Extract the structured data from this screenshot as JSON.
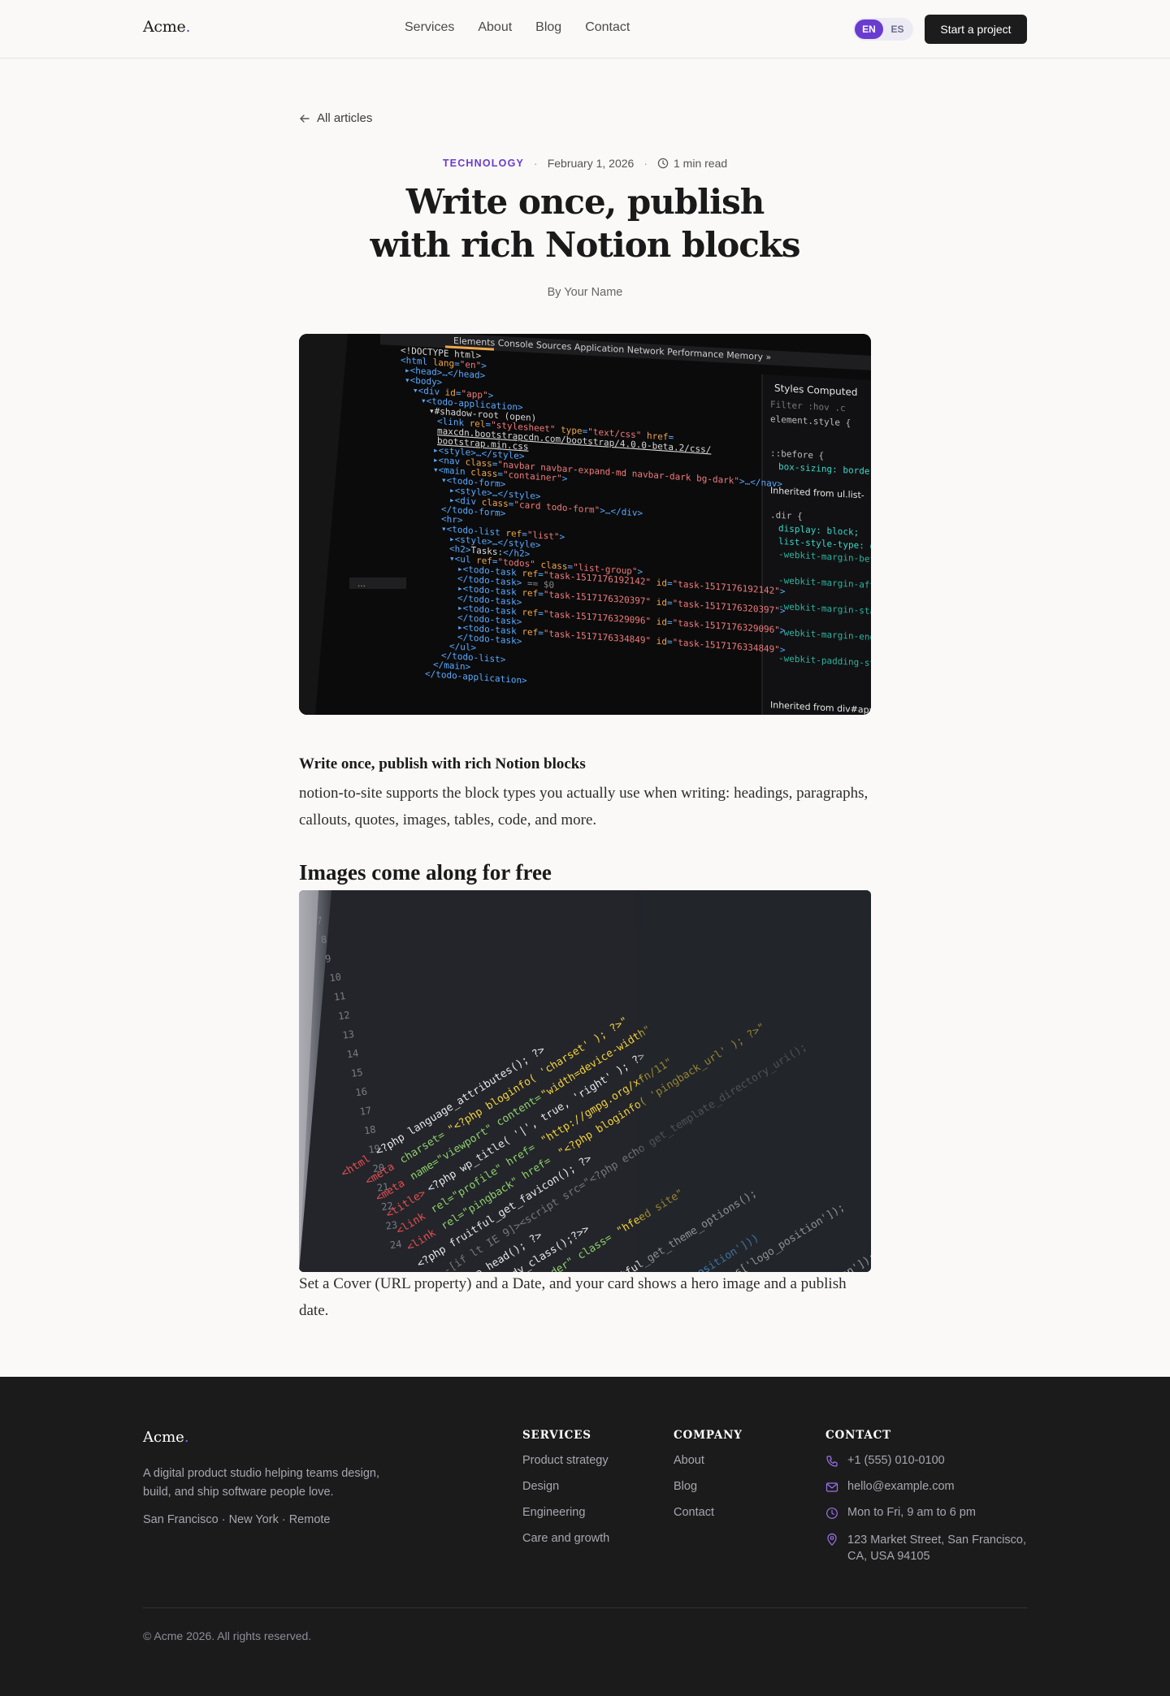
{
  "header": {
    "logo": "Acme",
    "logo_dot": ".",
    "nav": [
      "Services",
      "About",
      "Blog",
      "Contact"
    ],
    "lang_active": "EN",
    "lang_inactive": "ES",
    "cta": "Start a project"
  },
  "article": {
    "back_label": "All articles",
    "category": "TECHNOLOGY",
    "date": "February 1, 2026",
    "read_time": "1 min read",
    "title_line1": "Write once, publish",
    "title_line2": "with rich Notion blocks",
    "byline": "By Your Name",
    "body_heading": "Write once, publish with rich Notion blocks",
    "body_paragraph": "notion-to-site supports the block types you actually use when writing: headings, paragraphs, callouts, quotes, images, tables, code, and more.",
    "section_heading": "Images come along for free",
    "section_paragraph": "Set a Cover (URL property) and a Date, and your card shows a hero image and a publish date."
  },
  "footer": {
    "logo": "Acme",
    "logo_dot": ".",
    "description": "A digital product studio helping teams design, build, and ship software people love.",
    "locations": "San Francisco · New York · Remote",
    "services_title": "SERVICES",
    "services": [
      "Product strategy",
      "Design",
      "Engineering",
      "Care and growth"
    ],
    "company_title": "COMPANY",
    "company": [
      "About",
      "Blog",
      "Contact"
    ],
    "contact_title": "CONTACT",
    "phone": "+1 (555) 010-0100",
    "email": "hello@example.com",
    "hours": "Mon to Fri, 9 am to 6 pm",
    "address": "123 Market Street, San Francisco, CA, USA 94105",
    "copyright": "© Acme 2026. All rights reserved."
  },
  "colors": {
    "accent": "#6a3bd1",
    "footer_bg": "#1b1b1b",
    "page_bg": "#faf9f7"
  }
}
